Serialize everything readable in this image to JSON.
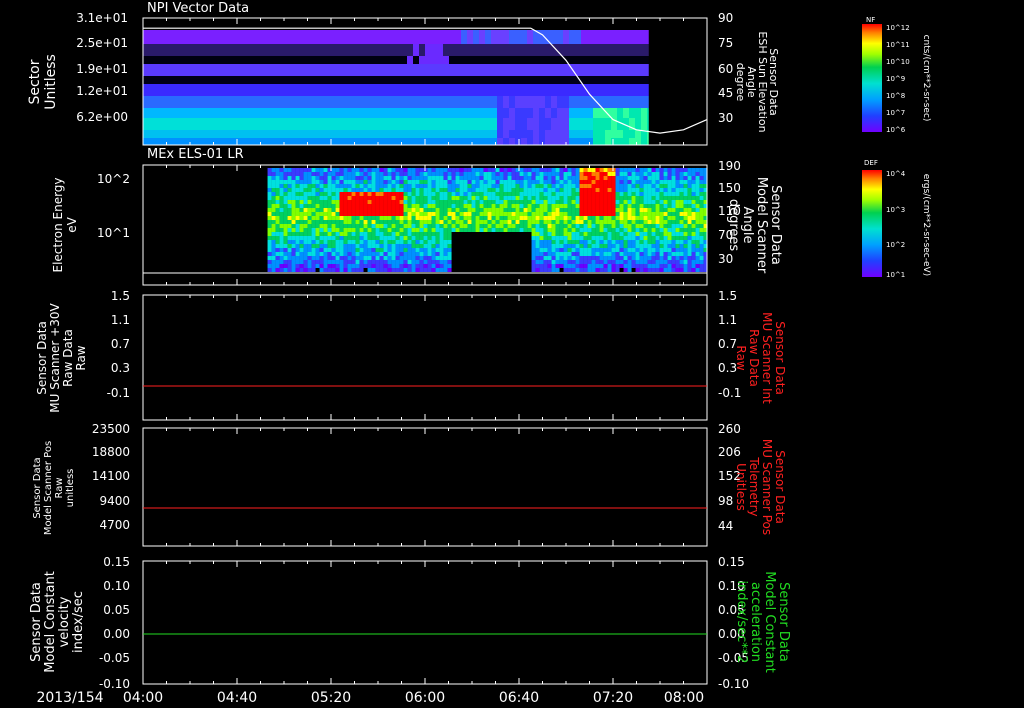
{
  "colors": {
    "background": "#000000",
    "axis": "#ffffff",
    "red_trace": "#ff2020",
    "green_trace": "#22dd22",
    "colormap": [
      "#6a00ff",
      "#3a3aff",
      "#0090ff",
      "#00e0e0",
      "#00d060",
      "#80ff00",
      "#ffff00",
      "#ff8000",
      "#ff0000"
    ]
  },
  "time_axis": {
    "date_label": "2013/154",
    "tick_labels": [
      "04:00",
      "04:40",
      "05:20",
      "06:00",
      "06:40",
      "07:20",
      "08:00"
    ],
    "start": "04:00",
    "end": "08:00"
  },
  "chart_data": [
    {
      "type": "heatmap",
      "title": "NPI Vector Data",
      "ylabel_lines": [
        "Sector",
        "Unitless"
      ],
      "y_tick_labels": [
        "3.1e+01",
        "2.5e+01",
        "1.9e+01",
        "1.2e+01",
        "6.2e+00"
      ],
      "right_ylabel_lines": [
        "Sensor Data",
        "ESH Sun Elevation",
        "Angle",
        "degree"
      ],
      "right_y_ticks": [
        90,
        75,
        60,
        45,
        30
      ],
      "right_ylim": [
        15,
        90
      ],
      "colorbar": {
        "label": "NF",
        "unit": "cnts/(cm**2-sr-sec)",
        "tick_labels": [
          "10^12",
          "10^11",
          "10^10",
          "10^9",
          "10^8",
          "10^7",
          "10^6"
        ]
      },
      "overlay_line": {
        "name": "Sun Elevation Angle",
        "x": [
          "04:00",
          "06:45",
          "06:50",
          "07:00",
          "07:10",
          "07:20",
          "07:30",
          "07:40",
          "07:50",
          "08:00"
        ],
        "y": [
          84,
          84,
          80,
          65,
          45,
          30,
          24,
          22,
          24,
          30
        ]
      }
    },
    {
      "type": "heatmap",
      "title": "MEx ELS-01 LR",
      "ylabel_lines": [
        "Electron Energy",
        "eV"
      ],
      "y_tick_labels": [
        "10^2",
        "10^1"
      ],
      "right_ylabel_lines": [
        "Sensor Data",
        "Model Scanner",
        "Angle",
        "degrees"
      ],
      "right_y_ticks": [
        190,
        150,
        110,
        70,
        30
      ],
      "right_ylim": [
        0,
        190
      ],
      "colorbar": {
        "label": "DEF",
        "unit": "ergs/(cm**2-sr-sec-eV)",
        "tick_labels": [
          "10^4",
          "10^3",
          "10^2",
          "10^1"
        ]
      }
    },
    {
      "type": "line",
      "ylabel_lines": [
        "Sensor Data",
        "MU Scanner +30V",
        "Raw Data",
        "Raw"
      ],
      "y_tick_labels": [
        "1.5",
        "1.1",
        "0.7",
        "0.3",
        "-0.1"
      ],
      "ylim": [
        -0.5,
        1.5
      ],
      "right_ylabel_lines": [
        "Sensor Data",
        "MU Scanner Int",
        "Raw Data",
        "Raw"
      ],
      "right_y_tick_labels": [
        "1.5",
        "1.1",
        "0.7",
        "0.3",
        "-0.1"
      ],
      "series": [
        {
          "x": [
            "04:00",
            "08:00"
          ],
          "y": [
            0,
            0
          ]
        }
      ]
    },
    {
      "type": "line",
      "ylabel_lines": [
        "Sensor Data",
        "Model Scanner Pos",
        "Raw",
        "unitless"
      ],
      "y_tick_labels": [
        "23500",
        "18800",
        "14100",
        "9400",
        "4700"
      ],
      "ylim": [
        0,
        23500
      ],
      "right_ylabel_lines": [
        "Sensor Data",
        "MU Scanner Pos",
        "Telemetry",
        "Unitless"
      ],
      "right_y_tick_labels": [
        "260",
        "206",
        "152",
        "98",
        "44"
      ],
      "series": [
        {
          "x": [
            "04:00",
            "08:00"
          ],
          "y": [
            8700,
            8700
          ]
        }
      ]
    },
    {
      "type": "line",
      "ylabel_lines": [
        "Sensor Data",
        "Model Constant",
        "velocity",
        "index/sec"
      ],
      "y_tick_labels": [
        "0.15",
        "0.10",
        "0.05",
        "0.00",
        "-0.05",
        "-0.10"
      ],
      "ylim": [
        -0.1,
        0.15
      ],
      "right_ylabel_lines": [
        "Sensor Data",
        "Model Constant",
        "acceleration",
        "index/sec**2"
      ],
      "right_y_tick_labels": [
        "0.15",
        "0.10",
        "0.05",
        "0.00",
        "-0.05",
        "-0.10"
      ],
      "series": [
        {
          "x": [
            "04:00",
            "08:00"
          ],
          "y": [
            0,
            0
          ]
        }
      ]
    }
  ]
}
